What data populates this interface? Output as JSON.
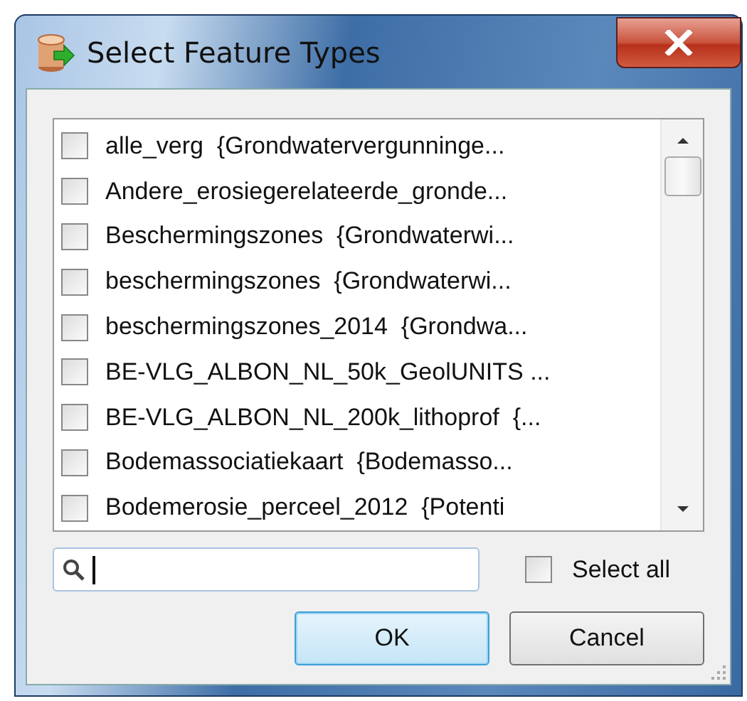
{
  "window": {
    "title": "Select Feature Types"
  },
  "items": [
    {
      "label": "alle_verg  {Grondwatervergunninge...",
      "checked": false
    },
    {
      "label": "Andere_erosiegerelateerde_gronde...",
      "checked": false
    },
    {
      "label": "Beschermingszones  {Grondwaterwi...",
      "checked": false
    },
    {
      "label": "beschermingszones  {Grondwaterwi...",
      "checked": false
    },
    {
      "label": "beschermingszones_2014  {Grondwa...",
      "checked": false
    },
    {
      "label": "BE-VLG_ALBON_NL_50k_GeolUNITS ...",
      "checked": false
    },
    {
      "label": "BE-VLG_ALBON_NL_200k_lithoprof  {...",
      "checked": false
    },
    {
      "label": "Bodemassociatiekaart  {Bodemasso...",
      "checked": false
    },
    {
      "label": "Bodemerosie_perceel_2012  {Potenti",
      "checked": false
    }
  ],
  "select_all": {
    "label": "Select all",
    "checked": false
  },
  "buttons": [
    {
      "label": "OK",
      "kind": "default"
    },
    {
      "label": "Cancel",
      "kind": "normal"
    }
  ]
}
